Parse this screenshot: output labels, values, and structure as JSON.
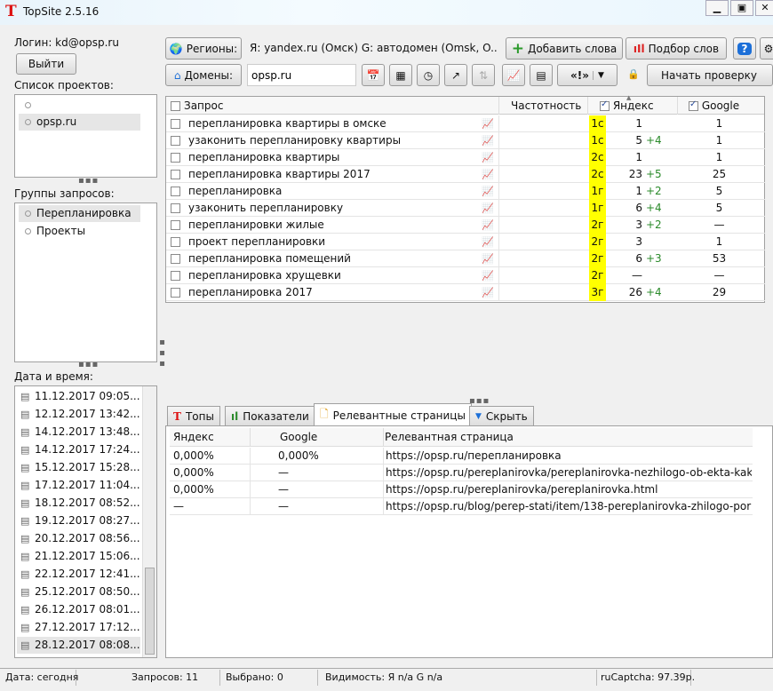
{
  "window": {
    "title": "TopSite 2.5.16",
    "logo": "T"
  },
  "left": {
    "login": "Логин: kd@opsp.ru",
    "logout": "Выйти",
    "projects_label": "Список проектов:",
    "projects": [
      "",
      "opsp.ru"
    ],
    "groups_label": "Группы запросов:",
    "groups": [
      "Перепланировка",
      "Проекты"
    ],
    "dates_label": "Дата и время:",
    "dates": [
      "11.12.2017 09:05...",
      "12.12.2017 13:42...",
      "14.12.2017 13:48...",
      "14.12.2017 17:24...",
      "15.12.2017 15:28...",
      "17.12.2017 11:04...",
      "18.12.2017 08:52...",
      "19.12.2017 08:27...",
      "20.12.2017 08:56...",
      "21.12.2017 15:06...",
      "22.12.2017 12:41...",
      "25.12.2017 08:50...",
      "26.12.2017 08:01...",
      "27.12.2017 17:12...",
      "28.12.2017 08:08..."
    ]
  },
  "toolbar": {
    "regions": "Регионы:",
    "regions_info": "Я: yandex.ru (Омск)  G: автодомен (Omsk, O...",
    "add_words": "Добавить слова",
    "word_select": "Подбор слов",
    "help": "?",
    "domains": "Домены:",
    "domain_value": "opsp.ru",
    "start_check": "Начать проверку",
    "split": "«!»"
  },
  "table": {
    "headers": {
      "query": "Запрос",
      "freq": "Частотность",
      "yandex": "Яндекс",
      "google": "Google"
    },
    "rows": [
      {
        "q": "перепланировка квартиры в омске",
        "tag": "1с",
        "y": "1",
        "d": "",
        "g": "1"
      },
      {
        "q": "узаконить перепланировку квартиры",
        "tag": "1с",
        "y": "5",
        "d": "+4",
        "g": "1"
      },
      {
        "q": "перепланировка квартиры",
        "tag": "2с",
        "y": "1",
        "d": "",
        "g": "1"
      },
      {
        "q": "перепланировка квартиры 2017",
        "tag": "2с",
        "y": "23",
        "d": "+5",
        "g": "25"
      },
      {
        "q": "перепланировка",
        "tag": "1г",
        "y": "1",
        "d": "+2",
        "g": "5"
      },
      {
        "q": "узаконить перепланировку",
        "tag": "1г",
        "y": "6",
        "d": "+4",
        "g": "5"
      },
      {
        "q": "перепланировки жилые",
        "tag": "2г",
        "y": "3",
        "d": "+2",
        "g": "—"
      },
      {
        "q": "проект перепланировки",
        "tag": "2г",
        "y": "3",
        "d": "",
        "g": "1"
      },
      {
        "q": "перепланировка помещений",
        "tag": "2г",
        "y": "6",
        "d": "+3",
        "g": "53"
      },
      {
        "q": "перепланировка хрущевки",
        "tag": "2г",
        "y": "—",
        "d": "",
        "g": "—"
      },
      {
        "q": "перепланировка 2017",
        "tag": "3г",
        "y": "26",
        "d": "+4",
        "g": "29"
      }
    ]
  },
  "tabs": [
    "Топы",
    "Показатели",
    "Релевантные страницы",
    "Скрыть"
  ],
  "relevant": {
    "headers": {
      "yandex": "Яндекс",
      "google": "Google",
      "page": "Релевантная страница"
    },
    "rows": [
      {
        "y": "0,000%",
        "g": "0,000%",
        "url": "https://opsp.ru/перепланировка"
      },
      {
        "y": "0,000%",
        "g": "—",
        "url": "https://opsp.ru/pereplanirovka/pereplanirovka-nezhilogo-ob-ekta-kak-"
      },
      {
        "y": "0,000%",
        "g": "—",
        "url": "https://opsp.ru/pereplanirovka/pereplanirovka.html"
      },
      {
        "y": "—",
        "g": "—",
        "url": "https://opsp.ru/blog/perep-stati/item/138-pereplanirovka-zhilogo-por"
      }
    ]
  },
  "status": {
    "date": "Дата: сегодня",
    "queries": "Запросов: 11",
    "selected": "Выбрано: 0",
    "visibility": "Видимость:  Я n/a  G n/a",
    "captcha": "ruCaptcha: 97.39р."
  },
  "colors": {
    "highlight": "#ffff00",
    "delta": "#2a8a2a",
    "logo": "#dd1111"
  }
}
